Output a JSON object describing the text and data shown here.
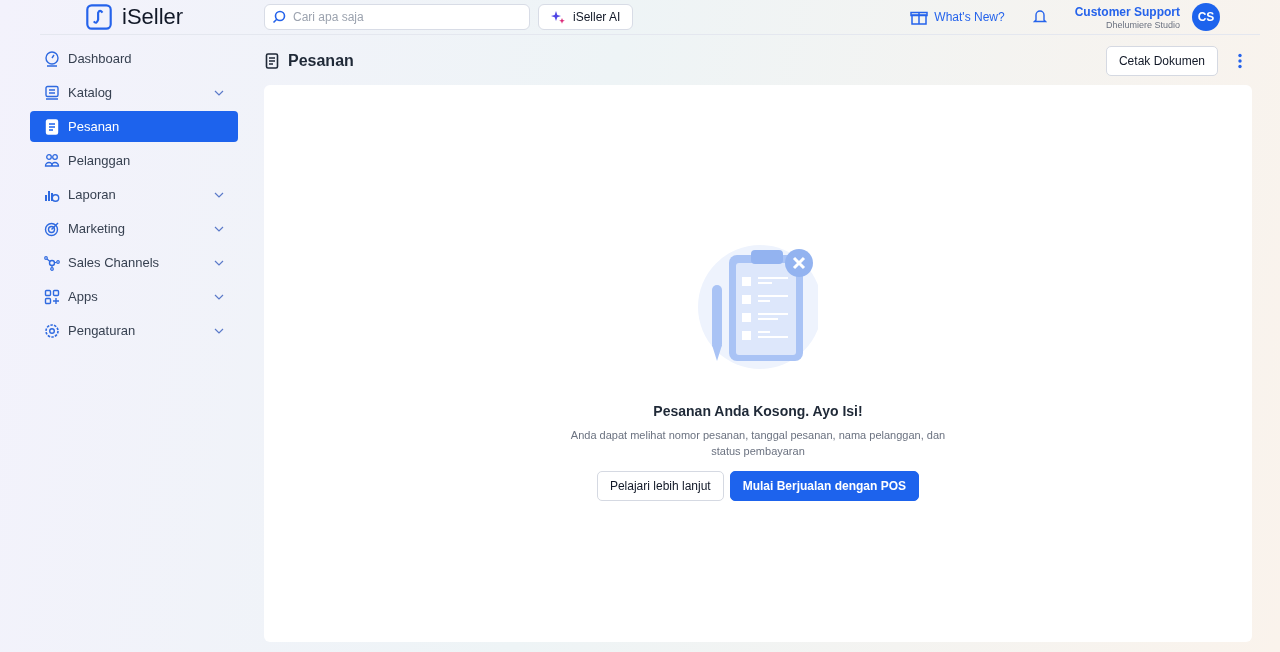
{
  "header": {
    "logo": "iSeller",
    "search": {
      "placeholder": "Cari apa saja"
    },
    "ai_button": "iSeller AI",
    "whats_new": "What's New?",
    "user": {
      "name": "Customer Support",
      "store": "Dhelumiere Studio",
      "initials": "CS"
    }
  },
  "sidebar": {
    "items": [
      {
        "label": "Dashboard",
        "expandable": false,
        "selected": false
      },
      {
        "label": "Katalog",
        "expandable": true,
        "selected": false
      },
      {
        "label": "Pesanan",
        "expandable": false,
        "selected": true
      },
      {
        "label": "Pelanggan",
        "expandable": false,
        "selected": false
      },
      {
        "label": "Laporan",
        "expandable": true,
        "selected": false
      },
      {
        "label": "Marketing",
        "expandable": true,
        "selected": false
      },
      {
        "label": "Sales Channels",
        "expandable": true,
        "selected": false
      },
      {
        "label": "Apps",
        "expandable": true,
        "selected": false
      },
      {
        "label": "Pengaturan",
        "expandable": true,
        "selected": false
      }
    ]
  },
  "page": {
    "title": "Pesanan",
    "print_button": "Cetak Dokumen"
  },
  "empty_state": {
    "title": "Pesanan Anda Kosong. Ayo Isi!",
    "description": "Anda dapat melihat nomor pesanan, tanggal pesanan, nama pelanggan, dan status pembayaran",
    "secondary_button": "Pelajari lebih lanjut",
    "primary_button": "Mulai Berjualan dengan POS"
  }
}
